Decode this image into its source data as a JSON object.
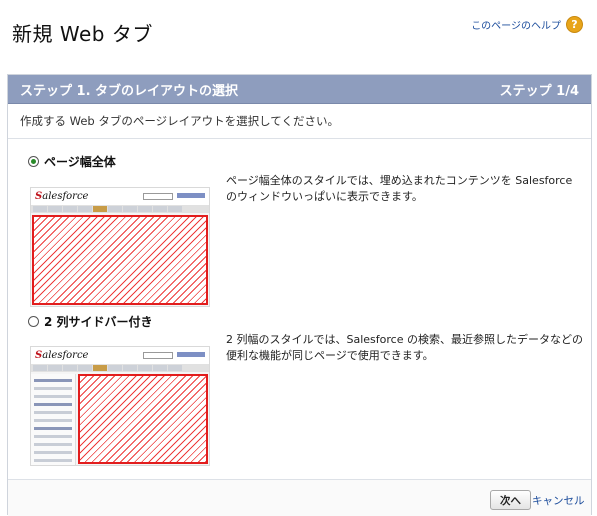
{
  "header": {
    "title": "新規 Web タブ",
    "help_link": "このページのヘルプ",
    "help_icon": "?"
  },
  "panel": {
    "step_title": "ステップ 1. タブのレイアウトの選択",
    "step_count": "ステップ 1/4",
    "instruction": "作成する Web タブのページレイアウトを選択してください。"
  },
  "options": [
    {
      "label": "ページ幅全体",
      "selected": true,
      "description": "ページ幅全体のスタイルでは、埋め込まれたコンテンツを Salesforce のウィンドウいっぱいに表示できます。"
    },
    {
      "label": "2 列サイドバー付き",
      "selected": false,
      "description": "2 列幅のスタイルでは、Salesforce の検索、最近参照したデータなどの便利な機能が同じページで使用できます。"
    }
  ],
  "preview": {
    "logo_prefix": "S",
    "logo_text": "alesforce"
  },
  "footer": {
    "next_label": "次へ",
    "cancel_label": "キャンセル"
  }
}
